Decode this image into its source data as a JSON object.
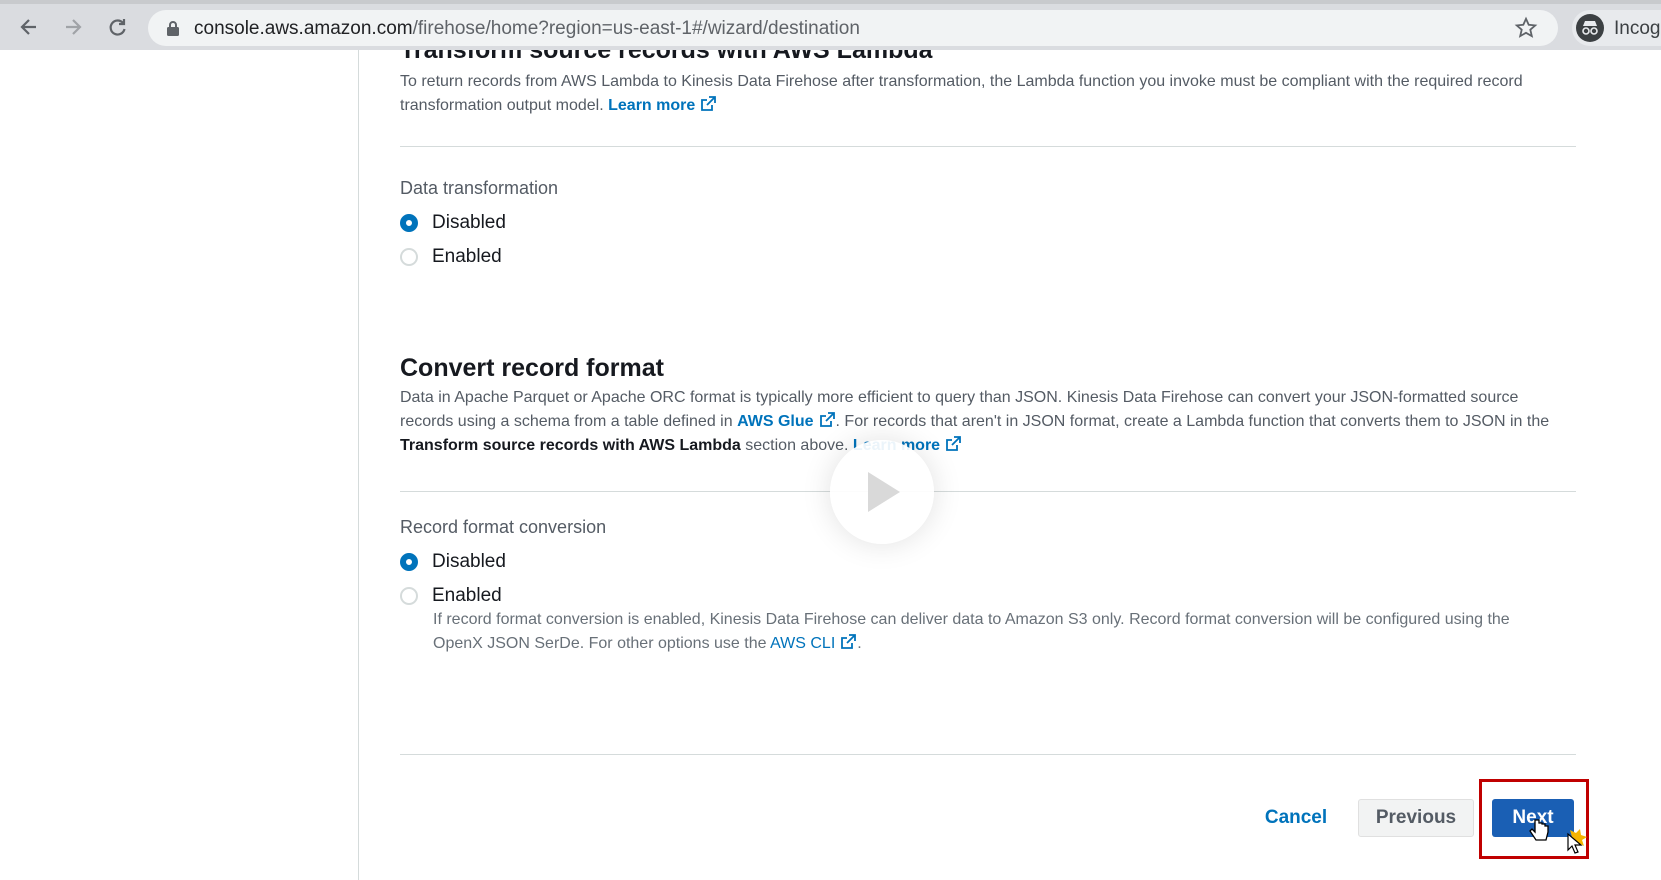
{
  "browser": {
    "url_host": "console.aws.amazon.com",
    "url_path": "/firehose/home?region=us-east-1#/wizard/destination",
    "profile_label": "Incog"
  },
  "transform": {
    "title": "Transform source records with AWS Lambda",
    "description": "To return records from AWS Lambda to Kinesis Data Firehose after transformation, the Lambda function you invoke must be compliant with the required record transformation output model.",
    "learn_more": "Learn more",
    "field_label": "Data transformation",
    "options": [
      {
        "label": "Disabled",
        "selected": true
      },
      {
        "label": "Enabled",
        "selected": false
      }
    ]
  },
  "convert": {
    "title": "Convert record format",
    "description_1": "Data in Apache Parquet or Apache ORC format is typically more efficient to query than JSON. Kinesis Data Firehose can convert your JSON-formatted source records using a schema from a table defined in",
    "glue_link": "AWS Glue",
    "description_2": ". For records that aren't in JSON format, create a Lambda function that converts them to JSON in the",
    "description_bold": "Transform source records with AWS Lambda",
    "description_3": "section above.",
    "learn_more": "Learn more",
    "field_label": "Record format conversion",
    "options": [
      {
        "label": "Disabled",
        "selected": true
      },
      {
        "label": "Enabled",
        "selected": false
      }
    ],
    "hint_1": "If record format conversion is enabled, Kinesis Data Firehose can deliver data to Amazon S3 only. Record format conversion will be configured using the OpenX JSON SerDe. For other options use the",
    "cli_link": "AWS CLI",
    "hint_2": "."
  },
  "footer": {
    "cancel": "Cancel",
    "previous": "Previous",
    "next": "Next"
  },
  "colors": {
    "link": "#0073bb",
    "primary_button": "#1a5fb4",
    "highlight": "#c00000"
  }
}
